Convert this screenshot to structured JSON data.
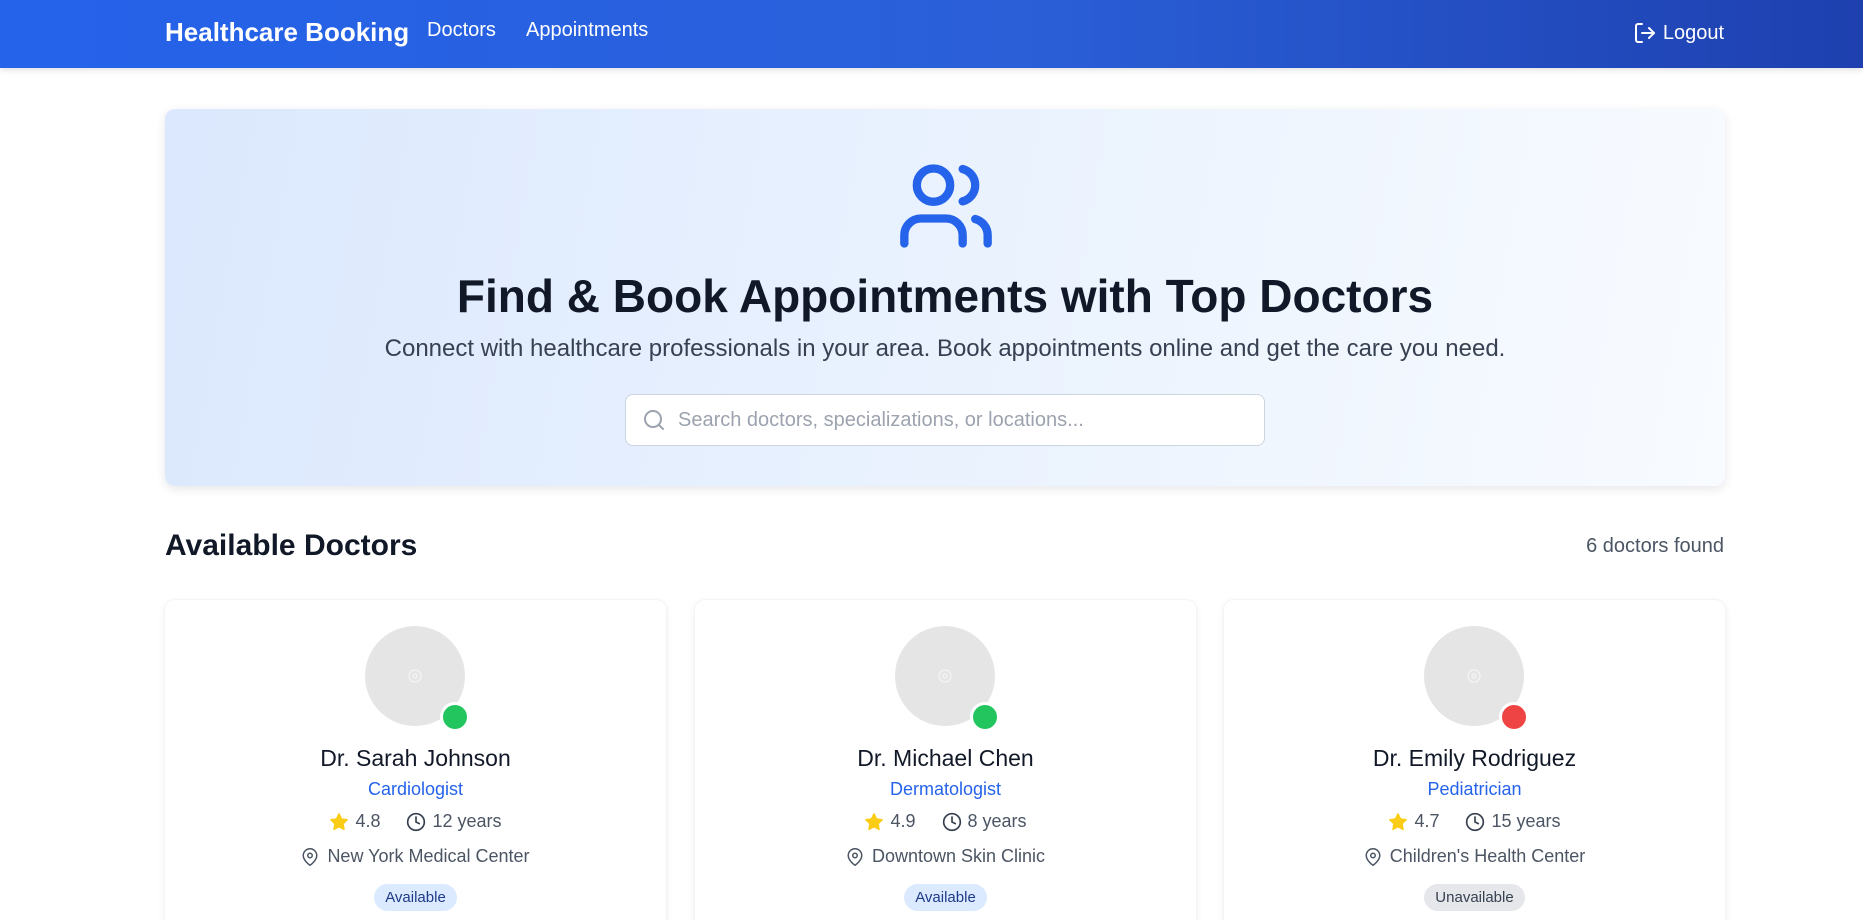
{
  "nav": {
    "brand": "Healthcare Booking",
    "links": [
      "Doctors",
      "Appointments"
    ],
    "logout_label": "Logout"
  },
  "hero": {
    "icon": "users-icon",
    "title": "Find & Book Appointments with Top Doctors",
    "subtitle": "Connect with healthcare professionals in your area. Book appointments online and get the care you need.",
    "search": {
      "placeholder": "Search doctors, specializations, or locations...",
      "value": ""
    }
  },
  "section": {
    "title": "Available Doctors",
    "count_text": "6 doctors found"
  },
  "doctors": [
    {
      "name": "Dr. Sarah Johnson",
      "specialization": "Cardiologist",
      "rating": "4.8",
      "experience": "12 years",
      "location": "New York Medical Center",
      "status": "Available",
      "online": true
    },
    {
      "name": "Dr. Michael Chen",
      "specialization": "Dermatologist",
      "rating": "4.9",
      "experience": "8 years",
      "location": "Downtown Skin Clinic",
      "status": "Available",
      "online": true
    },
    {
      "name": "Dr. Emily Rodriguez",
      "specialization": "Pediatrician",
      "rating": "4.7",
      "experience": "15 years",
      "location": "Children's Health Center",
      "status": "Unavailable",
      "online": false
    }
  ],
  "colors": {
    "primary": "#2563eb",
    "online": "#22c55e",
    "offline": "#ef4444",
    "star": "#facc15"
  }
}
